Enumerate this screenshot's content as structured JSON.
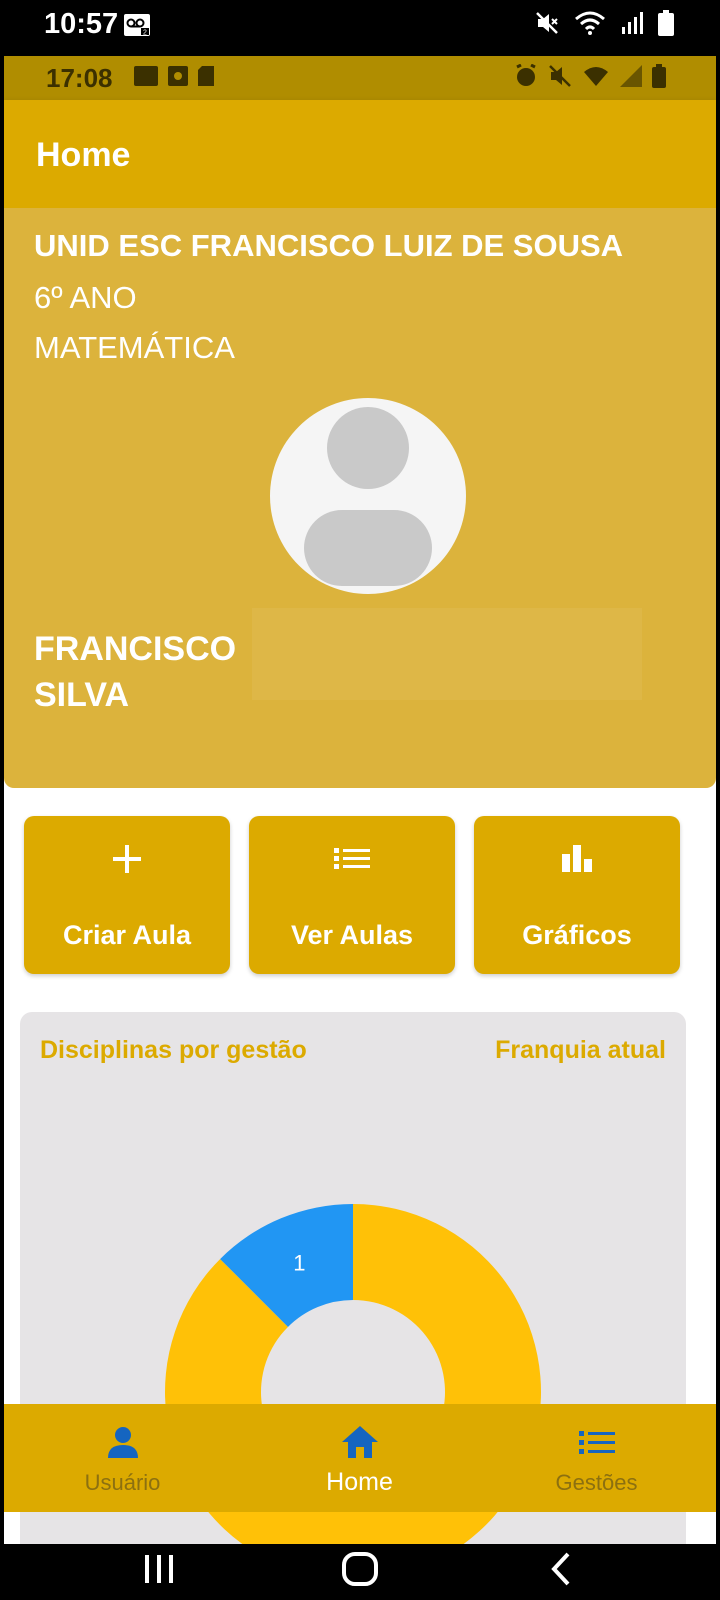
{
  "outer_status": {
    "time": "10:57"
  },
  "inner_status": {
    "time": "17:08"
  },
  "appbar": {
    "title": "Home"
  },
  "profile": {
    "school": "UNID ESC FRANCISCO LUIZ DE SOUSA",
    "grade": "6º ANO",
    "subject": "MATEMÁTICA",
    "name_line1": "FRANCISCO",
    "name_line2": "SILVA"
  },
  "actions": {
    "criar_label": "Criar Aula",
    "ver_label": "Ver Aulas",
    "graficos_label": "Gráficos"
  },
  "chart_card": {
    "title": "Disciplinas por gestão",
    "subtitle_right": "Franquia atual"
  },
  "chart_data": {
    "type": "pie",
    "segments": [
      {
        "value": 1,
        "color": "#2196f3",
        "label": "1"
      },
      {
        "value": 7,
        "color": "#ffc107",
        "label": ""
      }
    ]
  },
  "nav": {
    "usuario_label": "Usuário",
    "home_label": "Home",
    "gestoes_label": "Gestões"
  },
  "colors": {
    "accent": "#dcaa00",
    "card": "#dcb33c",
    "nav_active_icon": "#1565c0",
    "chart_blue": "#2196f3",
    "chart_yellow": "#ffc107"
  },
  "icons": {
    "outer_status": [
      "voicemail-icon",
      "mute-icon",
      "wifi-icon",
      "signal-icon",
      "battery-icon"
    ],
    "actions": [
      "plus-icon",
      "list-icon",
      "bar-chart-icon"
    ],
    "nav": [
      "person-icon",
      "home-icon",
      "list-icon"
    ]
  }
}
